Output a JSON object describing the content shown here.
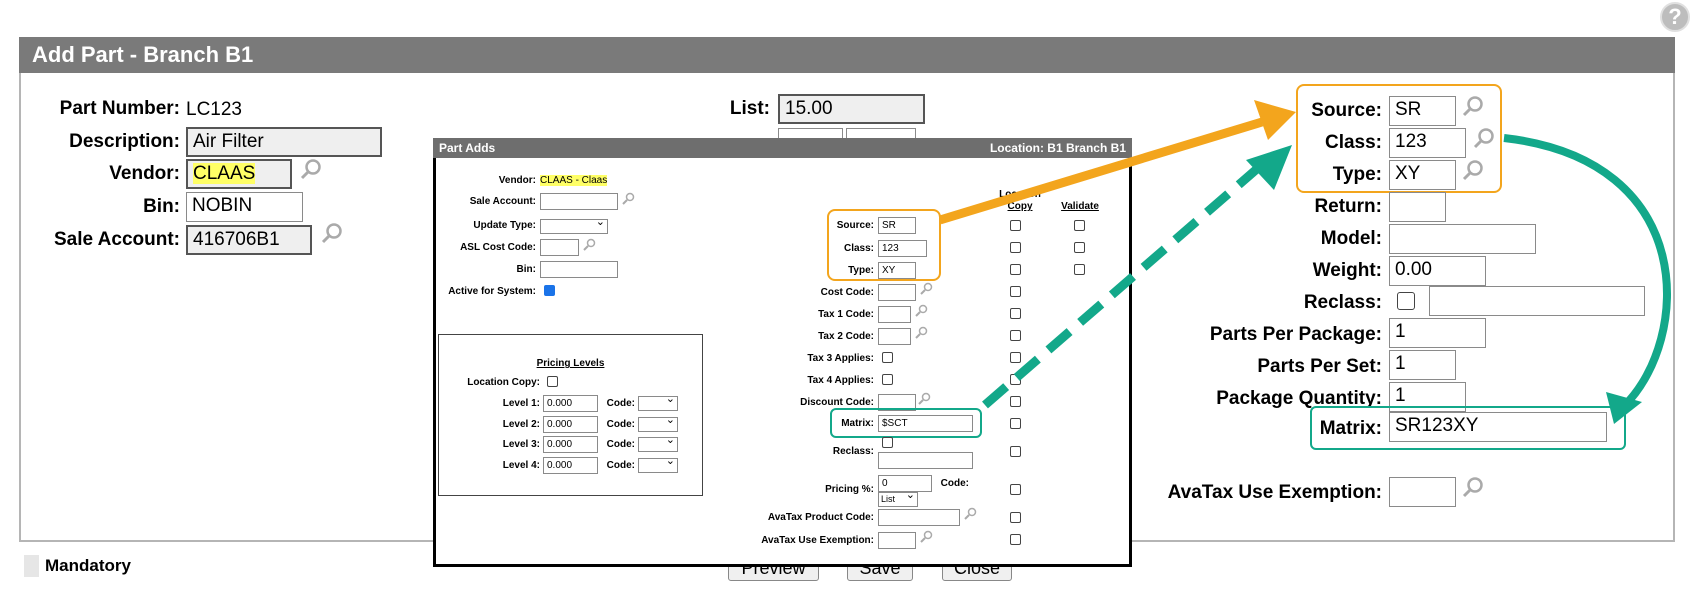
{
  "page": {
    "title": "Add Part -  Branch B1",
    "help_icon": "question-icon",
    "mandatory_label": "Mandatory"
  },
  "left_fields": {
    "part_number_label": "Part Number:",
    "part_number_value": "LC123",
    "description_label": "Description:",
    "description_value": "Air Filter",
    "vendor_label": "Vendor:",
    "vendor_value": "CLAAS",
    "bin_label": "Bin:",
    "bin_value": "NOBIN",
    "sale_account_label": "Sale Account:",
    "sale_account_value": "416706B1"
  },
  "middle_fields": {
    "list_label": "List:",
    "list_value": "15.00"
  },
  "right_fields": {
    "source_label": "Source:",
    "source_value": "SR",
    "class_label": "Class:",
    "class_value": "123",
    "type_label": "Type:",
    "type_value": "XY",
    "return_label": "Return:",
    "return_value": "",
    "model_label": "Model:",
    "model_value": "",
    "weight_label": "Weight:",
    "weight_value": "0.00",
    "reclass_label": "Reclass:",
    "reclass_value": "",
    "ppp_label": "Parts Per Package:",
    "ppp_value": "1",
    "pps_label": "Parts Per Set:",
    "pps_value": "1",
    "pkgqty_label": "Package Quantity:",
    "pkgqty_value": "1",
    "matrix_label": "Matrix:",
    "matrix_value": "SR123XY",
    "avatax_label": "AvaTax Use Exemption:",
    "avatax_value": ""
  },
  "buttons": {
    "preview": "Preview",
    "save": "Save",
    "close": "Close"
  },
  "popup": {
    "title": "Part Adds",
    "location": "Location:  B1 Branch B1",
    "vendor_label": "Vendor:",
    "vendor_value": "CLAAS - Claas",
    "sale_account_label": "Sale Account:",
    "update_type_label": "Update Type:",
    "asl_cost_code_label": "ASL Cost Code:",
    "bin_label": "Bin:",
    "active_label": "Active for System:",
    "pricing_title": "Pricing Levels",
    "location_copy_label": "Location Copy:",
    "levels": [
      {
        "label": "Level 1:",
        "value": "0.000",
        "code_label": "Code:"
      },
      {
        "label": "Level 2:",
        "value": "0.000",
        "code_label": "Code:"
      },
      {
        "label": "Level 3:",
        "value": "0.000",
        "code_label": "Code:"
      },
      {
        "label": "Level 4:",
        "value": "0.000",
        "code_label": "Code:"
      }
    ],
    "col_location_copy_top": "Location",
    "col_location_copy_bottom": "Copy",
    "col_validate": "Validate",
    "source_label": "Source:",
    "source_value": "SR",
    "class_label": "Class:",
    "class_value": "123",
    "type_label": "Type:",
    "type_value": "XY",
    "cost_code_label": "Cost Code:",
    "tax1_label": "Tax 1 Code:",
    "tax2_label": "Tax 2 Code:",
    "tax3_label": "Tax 3 Applies:",
    "tax4_label": "Tax 4 Applies:",
    "discount_label": "Discount Code:",
    "matrix_label": "Matrix:",
    "matrix_value": "$SCT",
    "reclass_label": "Reclass:",
    "pricing_pct_label": "Pricing %:",
    "pricing_pct_value": "0",
    "pricing_code_label": "Code:",
    "pricing_select": "List",
    "avatax_product_label": "AvaTax Product Code:",
    "avatax_use_label": "AvaTax Use Exemption:"
  },
  "colors": {
    "orange_annotation": "#f3a51d",
    "teal_annotation": "#13a88a",
    "titlebar": "#7a7a7a"
  }
}
